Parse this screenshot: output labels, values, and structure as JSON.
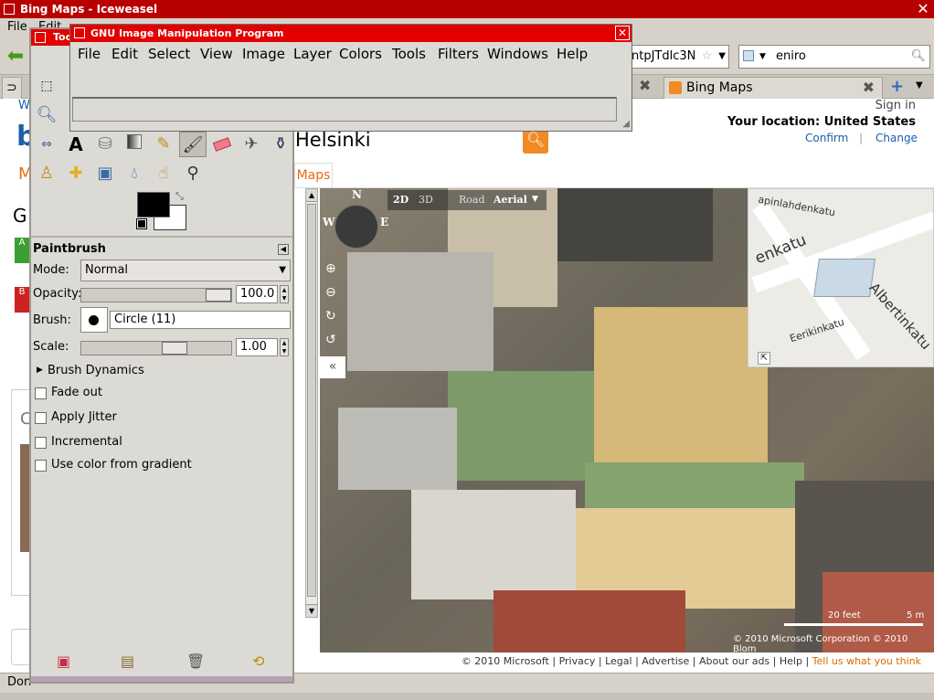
{
  "browser": {
    "title": "Bing Maps - Iceweasel",
    "menu": [
      "File",
      "Edit"
    ],
    "url_fragment": "ntpJTdlc3N",
    "search_value": "eniro",
    "tabs": [
      {
        "label": "Bing Maps"
      }
    ],
    "status": "Don"
  },
  "bing": {
    "sign_in": "Sign in",
    "location": "Your location: United States",
    "confirm": "Confirm",
    "change": "Change",
    "search_text": "Helsinki",
    "maps_tab": "Maps",
    "left_letters": [
      "W",
      "M",
      "G",
      "C"
    ],
    "map_controls": {
      "compass_n": "N",
      "compass_w": "W",
      "compass_e": "E",
      "mode_2d": "2D",
      "mode_3d": "3D",
      "road": "Road",
      "aerial": "Aerial"
    },
    "minimap_streets": [
      "apinlahdenkatu",
      "enkatu",
      "Albertinkatu",
      "Eerikinkatu"
    ],
    "scale": {
      "feet": "20 feet",
      "meters": "5 m"
    },
    "copyright": "© 2010 Microsoft Corporation  © 2010 Blom",
    "footer": [
      "© 2010 Microsoft",
      "Privacy",
      "Legal",
      "Advertise",
      "About our ads",
      "Help"
    ],
    "footer_highlight": "Tell us what you think"
  },
  "gimp": {
    "toolbox_title": "Too",
    "main_title": "GNU Image Manipulation Program",
    "menu": [
      "File",
      "Edit",
      "Select",
      "View",
      "Image",
      "Layer",
      "Colors",
      "Tools",
      "Filters",
      "Windows",
      "Help"
    ],
    "tool_options": {
      "heading": "Paintbrush",
      "mode_label": "Mode:",
      "mode_value": "Normal",
      "opacity_label": "Opacity:",
      "opacity_value": "100.0",
      "opacity_fraction": 1.0,
      "brush_label": "Brush:",
      "brush_value": "Circle (11)",
      "scale_label": "Scale:",
      "scale_value": "1.00",
      "dynamics": "Brush Dynamics",
      "checkboxes": [
        "Fade out",
        "Apply Jitter",
        "Incremental",
        "Use color from gradient"
      ]
    },
    "fg_color": "#000000",
    "bg_color": "#ffffff"
  },
  "colors": {
    "title_red": "#b90000",
    "gimp_title_red": "#e20000",
    "bing_blue": "#1a5fa8",
    "bing_orange": "#f08a24"
  }
}
